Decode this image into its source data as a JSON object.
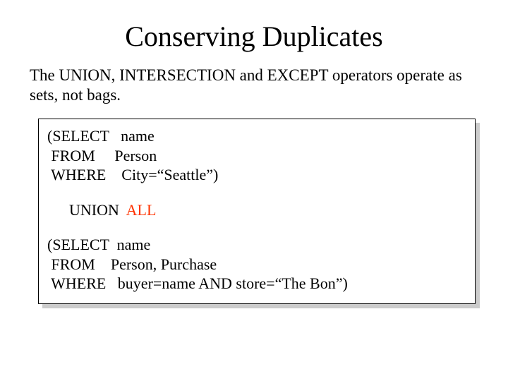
{
  "title": "Conserving Duplicates",
  "description": "The UNION, INTERSECTION and EXCEPT operators operate as sets, not bags.",
  "code": {
    "block1": {
      "l1": "(SELECT   name",
      "l2": " FROM     Person",
      "l3": " WHERE    City=“Seattle”)"
    },
    "union": {
      "prefix": "  UNION  ",
      "all": "ALL"
    },
    "block2": {
      "l1": "(SELECT  name",
      "l2": " FROM    Person, Purchase",
      "l3": " WHERE   buyer=name AND store=“The Bon”)"
    }
  }
}
